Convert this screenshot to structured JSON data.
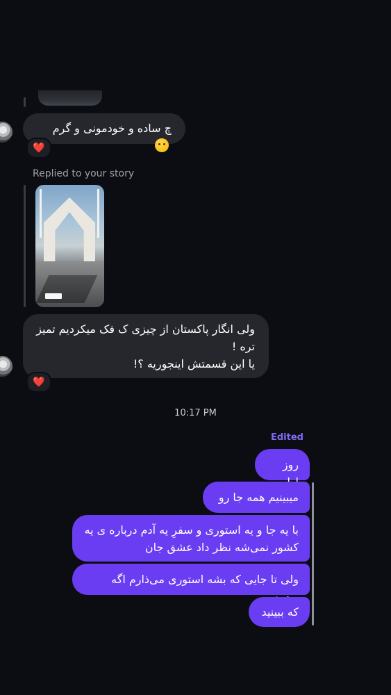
{
  "thread": {
    "incoming": [
      {
        "text": "چ ساده و خودمونی و گرم",
        "emoji": "upside-down-face",
        "reaction": "❤️"
      },
      {
        "lines": [
          "ولی انگار پاکستان از چیزی ک فک میکردیم تمیز",
          "تره !",
          "یا این قسمتش اینجوریه ؟!"
        ],
        "reaction": "❤️"
      }
    ],
    "reply_label": "Replied to your story",
    "timestamp": "10:17 PM",
    "edited_label": "Edited",
    "outgoing": [
      {
        "text": "روز اوله"
      },
      {
        "text": "میبینیم همه جا رو"
      },
      {
        "lines": [
          "با یه جا و یه استوری و سفرِ یه آدم درباره ی یه",
          "کشور نمی‌شه نظر داد عشق جان"
        ]
      },
      {
        "text": "ولی تا جایی که بشه استوری می‌ذارم اگه برسم"
      },
      {
        "text": "که ببینید"
      }
    ]
  },
  "colors": {
    "background": "#0c0d12",
    "incoming_bubble": "#26272c",
    "outgoing_bubble": "#6b3df2",
    "edited_accent": "#7d6cf5",
    "reaction_heart": "#e6283a"
  }
}
